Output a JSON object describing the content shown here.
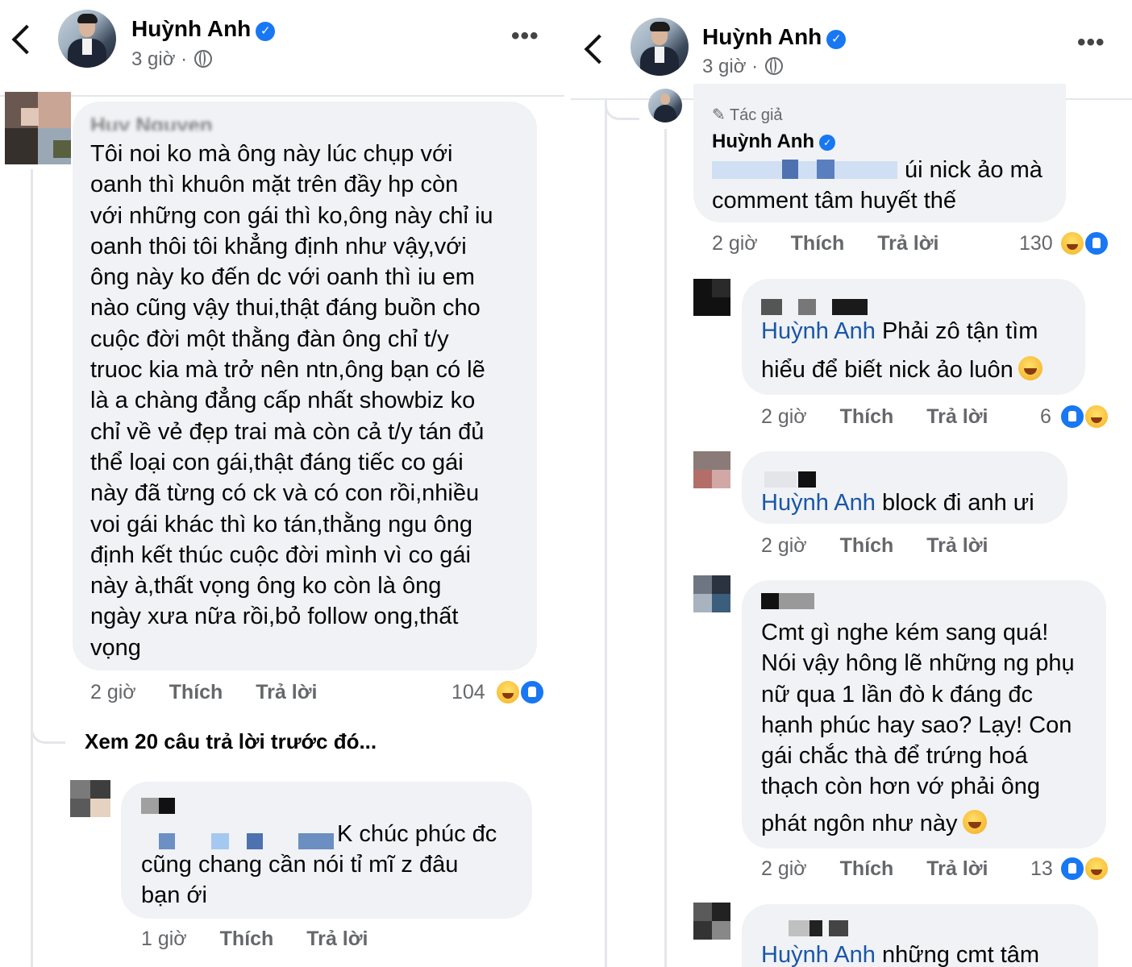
{
  "left": {
    "header": {
      "name": "Huỳnh Anh",
      "time": "3 giờ ·"
    },
    "comment1": {
      "author": "Huy Nguyen Hau",
      "text": "Tôi noi ko mà ông này lúc chụp với\noanh thì khuôn mặt trên đầy hp còn\nvới những con gái thì ko,ông này chỉ iu\noanh thôi tôi khẳng định như vậy,với\nông này ko đến dc với oanh thì iu em\nnào cũng vậy thui,thật đáng buồn cho\ncuộc đời một thằng đàn ông chỉ t/y\ntruoc kia mà trở nên ntn,ông bạn có lẽ\nlà a chàng đẳng cấp nhất showbiz ko\nchỉ về vẻ đẹp trai mà còn cả t/y tán đủ\nthể loại con gái,thật đáng tiếc co gái\nnày đã từng có ck và có con rồi,nhiều\nvoi gái khác thì ko tán,thằng ngu ông\nđịnh kết thúc cuộc đời mình vì co gái\nnày à,thất vọng ông ko còn là ông\nngày xưa nữa rồi,bỏ follow ong,thất\nvọng",
      "time": "2 giờ",
      "like": "Thích",
      "reply": "Trả lời",
      "reactions": "104"
    },
    "view_more": "Xem 20 câu trả lời trước đó...",
    "comment2": {
      "text_a": "K chúc phúc đc",
      "text_b": "cũng chang cần nói tỉ mĩ z đâu\nbạn ới",
      "time": "1 giờ",
      "like": "Thích",
      "reply": "Trả lời"
    }
  },
  "right": {
    "header": {
      "name": "Huỳnh Anh",
      "time": "3 giờ ·"
    },
    "author_reply": {
      "tag": "Tác giả",
      "name": "Huỳnh Anh",
      "text_a": "úi nick ảo mà",
      "text_b": "comment tâm huyết thế",
      "time": "2 giờ",
      "like": "Thích",
      "reply": "Trả lời",
      "reactions": "130"
    },
    "reply1": {
      "mention": "Huỳnh Anh",
      "text_a": " Phải zô tận tìm",
      "text_b": "hiểu để biết nick ảo luôn",
      "time": "2 giờ",
      "like": "Thích",
      "reply": "Trả lời",
      "reactions": "6"
    },
    "reply2": {
      "mention": "Huỳnh Anh",
      "text": " block đi anh ưi",
      "time": "2 giờ",
      "like": "Thích",
      "reply": "Trả lời"
    },
    "reply3": {
      "text": "Cmt gì nghe kém sang quá!\nNói vậy hông lẽ những ng phụ\nnữ qua 1 lần đò k đáng đc\nhạnh phúc hay sao? Lạy! Con\ngái   chắc thà để trứng hoá\nthạch còn hơn vớ phải ông",
      "text_last": "phát ngôn như này",
      "time": "2 giờ",
      "like": "Thích",
      "reply": "Trả lời",
      "reactions": "13"
    },
    "reply4": {
      "mention": "Huỳnh Anh",
      "text": " những cmt tâm"
    }
  },
  "icons": {
    "verified": "verified-badge-icon",
    "globe": "globe-icon",
    "back": "back-arrow-icon",
    "more": "more-dots-icon",
    "haha": "haha-reaction-icon",
    "like": "like-reaction-icon",
    "laugh_emoji": "rolling-laughing-emoji"
  },
  "colors": {
    "link": "#1a56a8",
    "verified": "#1877f2",
    "bubble": "#f0f2f5",
    "meta": "#65676b"
  }
}
